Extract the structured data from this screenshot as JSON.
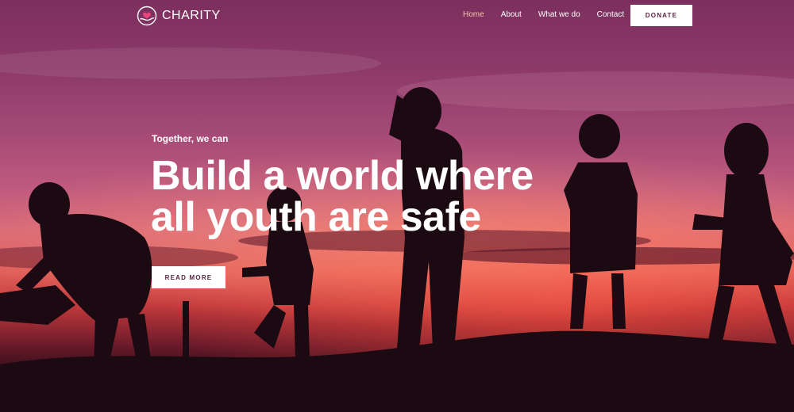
{
  "brand": {
    "name": "CHARITY",
    "logo_icon": "heart-hand-icon"
  },
  "nav": {
    "items": [
      {
        "label": "Home",
        "active": true
      },
      {
        "label": "About",
        "active": false
      },
      {
        "label": "What we do",
        "active": false
      },
      {
        "label": "Contact",
        "active": false
      }
    ],
    "cta_label": "DONATE"
  },
  "hero": {
    "eyebrow": "Together, we can",
    "headline_line1": "Build a world where",
    "headline_line2": "all youth are safe",
    "button_label": "READ MORE",
    "background": "sunset-silhouette-children-photo"
  },
  "colors": {
    "active_nav": "#f7c3b0",
    "button_text": "#5a2340",
    "sky_top": "#7c2f5e",
    "sky_horizon": "#e0605a"
  }
}
